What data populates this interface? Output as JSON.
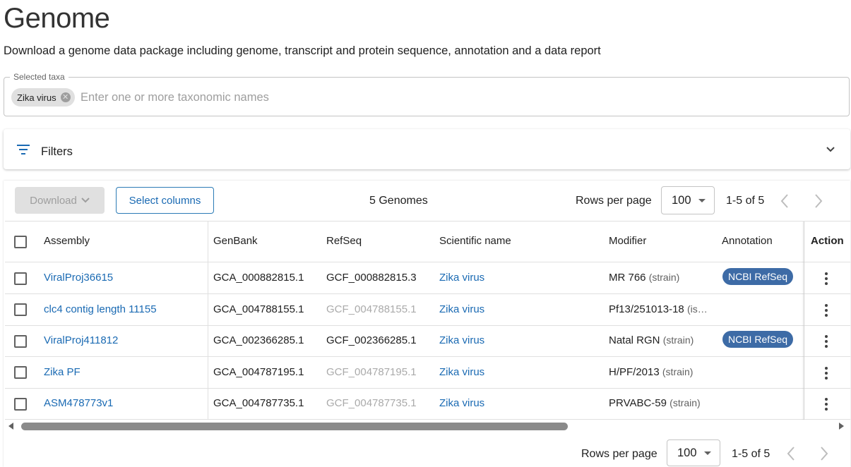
{
  "header": {
    "title": "Genome",
    "subtitle": "Download a genome data package including genome, transcript and protein sequence, annotation and a data report"
  },
  "taxa": {
    "legend": "Selected taxa",
    "chip_label": "Zika virus",
    "placeholder": "Enter one or more taxonomic names"
  },
  "filters": {
    "label": "Filters",
    "icon": "filter-icon"
  },
  "toolbar": {
    "download_label": "Download",
    "select_columns_label": "Select columns",
    "genome_count": "5 Genomes",
    "rows_per_page_label": "Rows per page",
    "rows_per_page_value": "100",
    "range": "1-5 of 5"
  },
  "table": {
    "columns": [
      "Assembly",
      "GenBank",
      "RefSeq",
      "Scientific name",
      "Modifier",
      "Annotation",
      "Action"
    ],
    "rows": [
      {
        "assembly": "ViralProj36615",
        "genbank": "GCA_000882815.1",
        "refseq": "GCF_000882815.3",
        "refseq_muted": false,
        "sci_name": "Zika virus",
        "modifier": "MR 766",
        "modifier_type": "(strain)",
        "annotation": "NCBI RefSeq"
      },
      {
        "assembly": "clc4 contig length 11155",
        "genbank": "GCA_004788155.1",
        "refseq": "GCF_004788155.1",
        "refseq_muted": true,
        "sci_name": "Zika virus",
        "modifier": "Pf13/251013-18",
        "modifier_type": "(is…",
        "annotation": ""
      },
      {
        "assembly": "ViralProj411812",
        "genbank": "GCA_002366285.1",
        "refseq": "GCF_002366285.1",
        "refseq_muted": false,
        "sci_name": "Zika virus",
        "modifier": "Natal RGN",
        "modifier_type": "(strain)",
        "annotation": "NCBI RefSeq"
      },
      {
        "assembly": "Zika PF",
        "genbank": "GCA_004787195.1",
        "refseq": "GCF_004787195.1",
        "refseq_muted": true,
        "sci_name": "Zika virus",
        "modifier": "H/PF/2013",
        "modifier_type": "(strain)",
        "annotation": ""
      },
      {
        "assembly": "ASM478773v1",
        "genbank": "GCA_004787735.1",
        "refseq": "GCF_004787735.1",
        "refseq_muted": true,
        "sci_name": "Zika virus",
        "modifier": "PRVABC-59",
        "modifier_type": "(strain)",
        "annotation": ""
      }
    ]
  },
  "footer": {
    "rows_per_page_label": "Rows per page",
    "rows_per_page_value": "100",
    "range": "1-5 of 5"
  },
  "colors": {
    "link": "#1a6ab3",
    "badge": "#3d6ba6",
    "muted": "#aaaaaa"
  }
}
